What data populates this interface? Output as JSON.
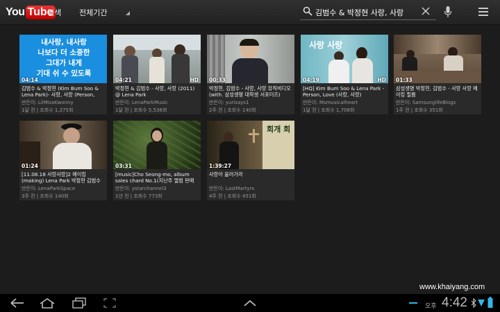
{
  "header": {
    "logo_you": "You",
    "logo_tube": "Tube",
    "search_tab": "검색",
    "filter_label": "전체기간",
    "search_query": "김범수 & 박정현 사랑, 사랑"
  },
  "videos": [
    {
      "duration": "04:14",
      "hd": "",
      "title": "김범수 & 박정현 (Kim Bum Soo & Lena Park)- 사랑, 사랑 (Person, Love)",
      "uploader": "만든이: LilMissKwonny",
      "meta": "1달 전 | 조회수 1,275회"
    },
    {
      "duration": "04:21",
      "hd": "HD",
      "title": "박정현 & 김범수 - 사랑, 사랑 (2011) @ Lena Park",
      "uploader": "만든이: LenaParkMusic",
      "meta": "1달 전 | 조회수 5,536회"
    },
    {
      "duration": "00:33",
      "hd": "",
      "title": "박정현, 김범수 - 사랑, 사랑 뮤직비디오 (with. 삼성생명 대학생 서포터즈)",
      "uploader": "만든이: yurisays1",
      "meta": "2주 전 | 조회수 140회"
    },
    {
      "duration": "04:19",
      "hd": "HD",
      "title": "[HQ] Kim Bum Soo & Lena Park - Person, Love (사랑, 사랑)",
      "uploader": "만든이: Msmusicalheart",
      "meta": "1달 전 | 조회수 1,708회"
    },
    {
      "duration": "01:33",
      "hd": "",
      "title": "삼성생명 박정현, 김범수 - 사랑 사랑 메이킹 필름",
      "uploader": "만든이: SamsunglifeBlogs",
      "meta": "1주 전 | 조회수 351회"
    },
    {
      "duration": "01:24",
      "hd": "",
      "title": "[11.08.18 사랑사랑]2 메이킹 (making) Lena Park 박정현 김범수",
      "uploader": "만든이: LenaParkSpace",
      "meta": "3주 전 | 조회수 140회"
    },
    {
      "duration": "03:31",
      "hd": "",
      "title": "[music]Cho Seong-mo, album sales chard No.1(지난주 앨범 판매 순위-",
      "uploader": "만든이: ystarchannel3",
      "meta": "1년 전 | 조회수 773회"
    },
    {
      "duration": "1:39:27",
      "hd": "",
      "title": "사랑아 울러가라",
      "uploader": "만든이: LastMartyrs",
      "meta": "4주 전 | 조회수 451회"
    }
  ],
  "thumb1_text": [
    "내사랑, 내사랑",
    "나보다 더 소중한",
    "그대가 내게",
    "기대 쉬 수 있도록"
  ],
  "thumb4_text": "사랑 사랑",
  "thumb8_sign": "회개 회",
  "watermark": "www.khaiyang.com",
  "system": {
    "ampm": "오후",
    "time": "4:42"
  },
  "colors": {
    "accent": "#33b5e5",
    "logo_red": "#cc1111"
  }
}
